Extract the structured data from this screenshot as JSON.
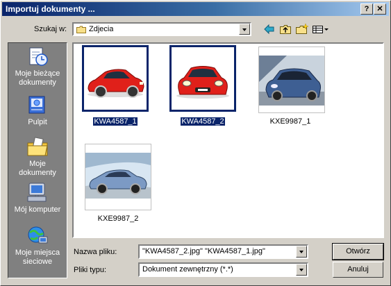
{
  "window": {
    "title": "Importuj dokumenty ...",
    "help_glyph": "?",
    "close_glyph": "✕"
  },
  "lookin": {
    "label": "Szukaj w:",
    "value": "Zdjecia"
  },
  "toolbar": {
    "icons": [
      "back-arrow-icon",
      "up-folder-icon",
      "new-folder-icon",
      "view-menu-icon"
    ]
  },
  "places": [
    {
      "label": "Moje bieżące dokumenty",
      "icon": "recent-documents-icon"
    },
    {
      "label": "Pulpit",
      "icon": "desktop-icon"
    },
    {
      "label": "Moje dokumenty",
      "icon": "my-documents-icon"
    },
    {
      "label": "Mój komputer",
      "icon": "my-computer-icon"
    },
    {
      "label": "Moje miejsca sieciowe",
      "icon": "network-places-icon"
    }
  ],
  "files": [
    {
      "name": "KWA4587_1",
      "selected": true
    },
    {
      "name": "KWA4587_2",
      "selected": true
    },
    {
      "name": "KXE9987_1",
      "selected": false
    },
    {
      "name": "KXE9987_2",
      "selected": false
    }
  ],
  "filename": {
    "label": "Nazwa pliku:",
    "value": "\"KWA4587_2.jpg\" \"KWA4587_1.jpg\""
  },
  "filetype": {
    "label": "Pliki typu:",
    "value": "Dokument zewnętrzny (*.*)"
  },
  "buttons": {
    "open": "Otwórz",
    "cancel": "Anuluj"
  },
  "colors": {
    "title_start": "#0a246a",
    "title_end": "#a6caf0",
    "selection": "#0a246a",
    "face": "#d4d0c8",
    "places_bg": "#808080"
  }
}
